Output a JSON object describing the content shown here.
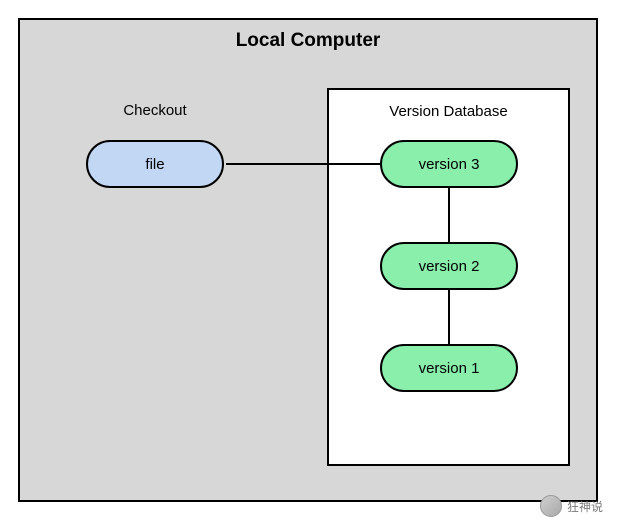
{
  "diagram": {
    "title": "Local Computer",
    "checkout": {
      "label": "Checkout",
      "file_label": "file"
    },
    "database": {
      "label": "Version Database",
      "versions": [
        {
          "label": "version 3"
        },
        {
          "label": "version 2"
        },
        {
          "label": "version 1"
        }
      ]
    }
  },
  "watermark": {
    "text": "狂神说"
  },
  "colors": {
    "panel_bg": "#d7d7d7",
    "node_blue": "#c2d7f4",
    "node_green": "#89efab",
    "border": "#000000"
  }
}
